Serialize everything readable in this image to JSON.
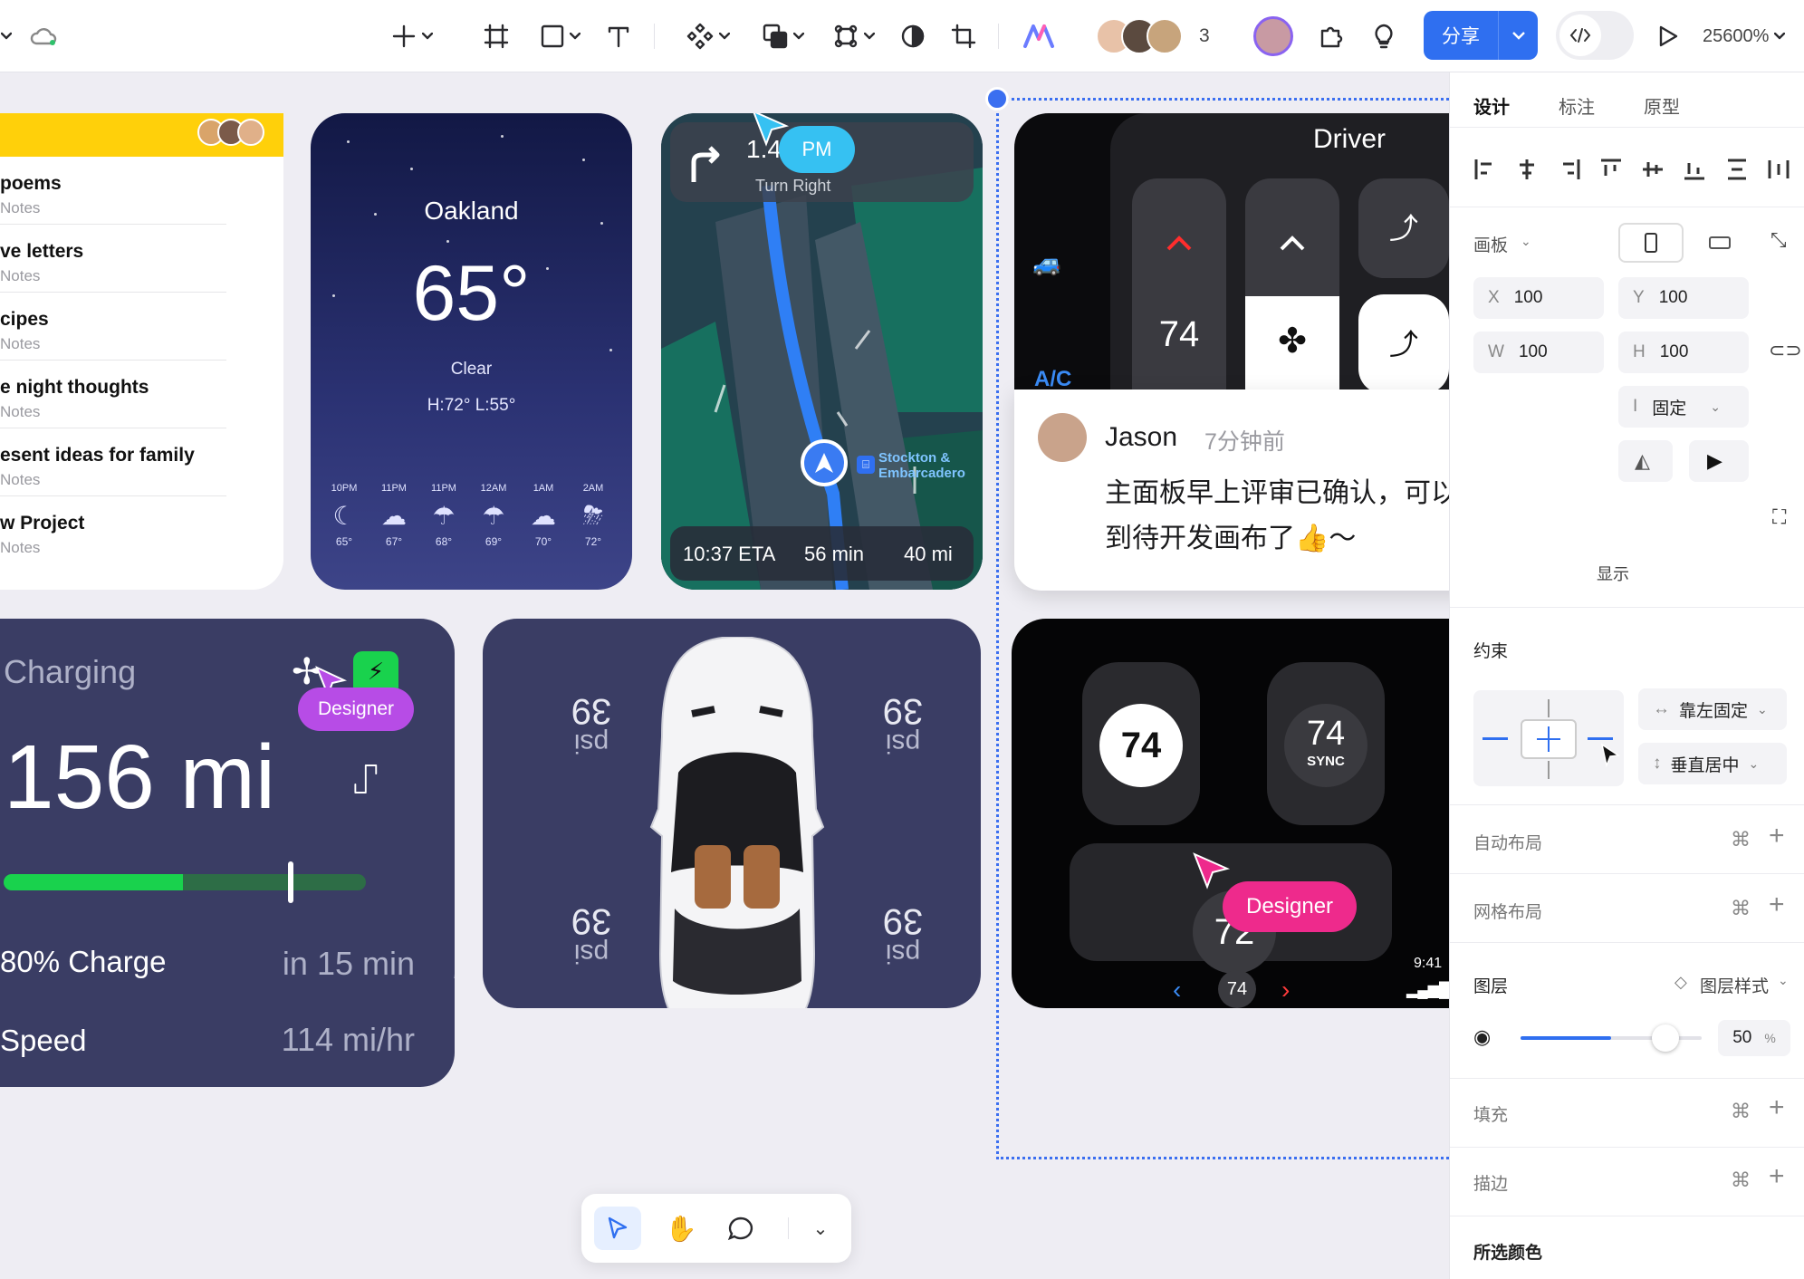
{
  "toolbar": {
    "collaborator_count": "3",
    "share_label": "分享",
    "zoom": "25600%"
  },
  "notes": {
    "items": [
      {
        "title": "poems",
        "sub": "Notes"
      },
      {
        "title": "ve letters",
        "sub": "Notes"
      },
      {
        "title": "cipes",
        "sub": "Notes"
      },
      {
        "title": "e night thoughts",
        "sub": "Notes"
      },
      {
        "title": "esent ideas for family",
        "sub": "Notes"
      },
      {
        "title": "w Project",
        "sub": "Notes"
      }
    ]
  },
  "weather": {
    "city": "Oakland",
    "temp": "65°",
    "cond": "Clear",
    "hilo": "H:72° L:55°",
    "hours": [
      {
        "t": "10PM",
        "icon": "moon-icon",
        "v": "65°"
      },
      {
        "t": "11PM",
        "icon": "cloud-night-icon",
        "v": "67°"
      },
      {
        "t": "11PM",
        "icon": "rain-icon",
        "v": "68°"
      },
      {
        "t": "12AM",
        "icon": "rain-icon",
        "v": "69°"
      },
      {
        "t": "1AM",
        "icon": "cloud-night-icon",
        "v": "70°"
      },
      {
        "t": "2AM",
        "icon": "storm-icon",
        "v": "72°"
      }
    ]
  },
  "map": {
    "dist": "1.4",
    "turn": "Turn Right",
    "pm_tag": "PM",
    "place1": "Stockton &",
    "place2": "Embarcadero",
    "eta": "10:37 ETA",
    "mins": "56 min",
    "miles": "40 mi"
  },
  "driver": {
    "title": "Driver",
    "ac": "A/C",
    "temp": "74"
  },
  "comment": {
    "author": "Jason",
    "time": "7分钟前",
    "line1": "主面板早上评审已确认，可以移动",
    "line2": "到待开发画布了👍～"
  },
  "charging": {
    "title": "Charging",
    "range": "156 mi",
    "charge_label": "80% Charge",
    "charge_time": "in 15 min",
    "speed_label": "Speed",
    "speed_value": "114 mi/hr",
    "charge_fraction": 0.8,
    "designer_tag": "Designer"
  },
  "car": {
    "psi_value": "39",
    "psi_unit": "psi"
  },
  "seats": {
    "left_temp": "74",
    "right_temp": "74",
    "right_sub": "SYNC",
    "rear_temp": "72",
    "nav_temp": "74",
    "clock": "9:41",
    "designer_tag": "Designer"
  },
  "panel": {
    "tabs": [
      "设计",
      "标注",
      "原型"
    ],
    "frame_label": "画板",
    "x_label": "X",
    "x_value": "100",
    "y_label": "Y",
    "y_value": "100",
    "w_label": "W",
    "w_value": "100",
    "h_label": "H",
    "h_value": "100",
    "fixed_label": "固定",
    "show_label": "显示",
    "constraint_title": "约束",
    "constraint_h": "靠左固定",
    "constraint_v": "垂直居中",
    "auto_layout": "自动布局",
    "grid_layout": "网格布局",
    "layer_title": "图层",
    "layer_style": "图层样式",
    "opacity": "50",
    "opacity_unit": "%",
    "opacity_fraction": 0.5,
    "fill": "填充",
    "stroke": "描边",
    "selected_colors": "所选颜色"
  },
  "colors": {
    "accent": "#2f6ff0",
    "designer_purple": "#b74ce6",
    "designer_pink": "#ee2a8c",
    "charge_green": "#19d24d"
  }
}
